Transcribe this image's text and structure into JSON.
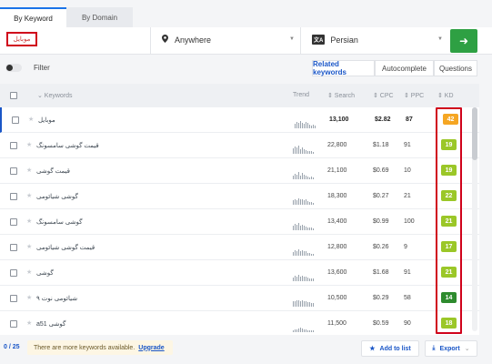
{
  "tabs": [
    {
      "label": "By Keyword",
      "active": true
    },
    {
      "label": "By Domain",
      "active": false
    }
  ],
  "search": {
    "keyword_value": "موبایل",
    "location": "Anywhere",
    "language": "Persian",
    "language_icon": "文A",
    "go_icon": "arrow-right-icon"
  },
  "filter": {
    "label": "Filter"
  },
  "modes": [
    {
      "label": "Related keywords",
      "active": true
    },
    {
      "label": "Autocomplete",
      "active": false
    },
    {
      "label": "Questions",
      "active": false
    }
  ],
  "table": {
    "headers": {
      "keywords": "⌄ Keywords",
      "trend": "Trend",
      "search": "⇕ Search",
      "cpc": "⇕ CPC",
      "ppc": "⇕ PPC",
      "kd": "⇕ KD"
    },
    "rows": [
      {
        "keyword": "موبایل",
        "search": "13,100",
        "cpc": "$2.82",
        "ppc": "87",
        "kd": "42",
        "kd_color": "#f5a623",
        "trend": [
          5,
          7,
          6,
          8,
          6,
          5,
          7,
          6,
          4,
          3,
          4,
          3
        ]
      },
      {
        "keyword": "قیمت گوشی سامسونگ",
        "search": "22,800",
        "cpc": "$1.18",
        "ppc": "91",
        "kd": "19",
        "kd_color": "#9bc728",
        "trend": [
          6,
          8,
          7,
          9,
          5,
          7,
          5,
          4,
          3,
          3,
          3,
          2
        ]
      },
      {
        "keyword": "قیمت گوشی",
        "search": "21,100",
        "cpc": "$0.69",
        "ppc": "10",
        "kd": "19",
        "kd_color": "#9bc728",
        "trend": [
          4,
          6,
          5,
          8,
          4,
          7,
          5,
          4,
          3,
          2,
          3,
          2
        ]
      },
      {
        "keyword": "گوشی شیائومی",
        "search": "18,300",
        "cpc": "$0.27",
        "ppc": "21",
        "kd": "22",
        "kd_color": "#9bc728",
        "trend": [
          5,
          6,
          5,
          7,
          6,
          6,
          5,
          6,
          4,
          3,
          3,
          2
        ]
      },
      {
        "keyword": "گوشی سامسونگ",
        "search": "13,400",
        "cpc": "$0.99",
        "ppc": "100",
        "kd": "21",
        "kd_color": "#9bc728",
        "trend": [
          5,
          7,
          6,
          8,
          5,
          6,
          5,
          4,
          3,
          3,
          3,
          2
        ]
      },
      {
        "keyword": "قیمت گوشی شیائومی",
        "search": "12,800",
        "cpc": "$0.26",
        "ppc": "9",
        "kd": "17",
        "kd_color": "#9bc728",
        "trend": [
          4,
          6,
          5,
          7,
          5,
          6,
          5,
          5,
          3,
          3,
          2,
          2
        ]
      },
      {
        "keyword": "گوشی",
        "search": "13,600",
        "cpc": "$1.68",
        "ppc": "91",
        "kd": "21",
        "kd_color": "#9bc728",
        "trend": [
          4,
          6,
          5,
          7,
          5,
          6,
          5,
          5,
          4,
          3,
          3,
          3
        ]
      },
      {
        "keyword": "شیائومی نوت ۹",
        "search": "10,500",
        "cpc": "$0.29",
        "ppc": "58",
        "kd": "14",
        "kd_color": "#2e8b2e",
        "trend": [
          6,
          6,
          7,
          7,
          6,
          7,
          6,
          6,
          5,
          5,
          4,
          4
        ]
      },
      {
        "keyword": "گوشی a51",
        "search": "11,500",
        "cpc": "$0.59",
        "ppc": "90",
        "kd": "18",
        "kd_color": "#9bc728",
        "trend": [
          2,
          3,
          3,
          4,
          5,
          4,
          3,
          3,
          2,
          2,
          2,
          2
        ]
      }
    ]
  },
  "footer": {
    "count": "0 / 25",
    "notice": "There are more keywords available.",
    "upgrade": "Upgrade",
    "add_to_list": "Add to list",
    "export": "Export"
  },
  "colors": {
    "accent": "#1a56c7",
    "go_button": "#2ea043",
    "highlight_box": "#d0021b"
  }
}
